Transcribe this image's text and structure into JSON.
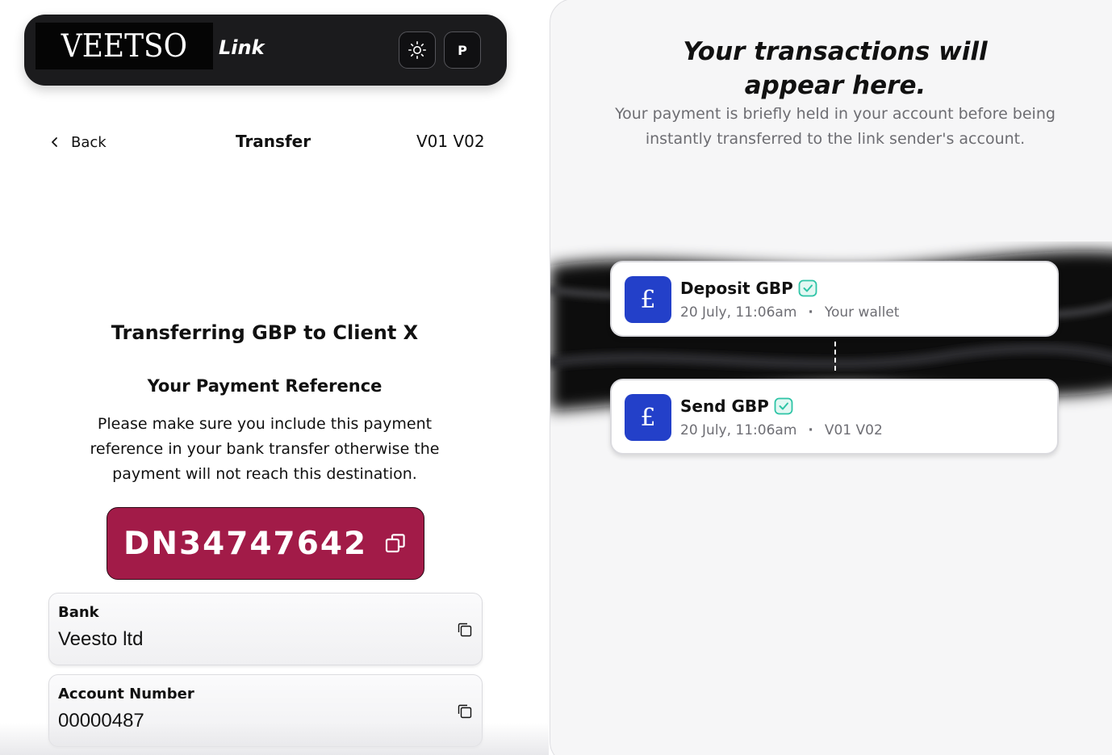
{
  "topbar": {
    "logo_text": "VEETSO",
    "product_label": "Link",
    "profile_initial": "P"
  },
  "nav": {
    "back_label": "Back",
    "title": "Transfer",
    "account_code": "V01 V02"
  },
  "transfer": {
    "heading": "Transferring GBP to Client X",
    "reference_heading": "Your Payment Reference",
    "reference_info": "Please make sure you include this payment reference in your bank transfer otherwise the payment will not reach this destination.",
    "reference_code": "DN34747642"
  },
  "fields": {
    "bank": {
      "label": "Bank",
      "value": "Veesto ltd"
    },
    "account_number": {
      "label": "Account Number",
      "value": "00000487"
    }
  },
  "transactions_panel": {
    "title": "Your transactions will appear here.",
    "subtitle": "Your payment is briefly held in your account before being instantly transferred to the link sender's account.",
    "items": [
      {
        "title": "Deposit GBP",
        "currency_symbol": "£",
        "date": "20 July, 11:06am",
        "target": "Your wallet"
      },
      {
        "title": "Send GBP",
        "currency_symbol": "£",
        "date": "20 July, 11:06am",
        "target": "V01 V02"
      }
    ],
    "separator": "·"
  },
  "colors": {
    "accent_reference": "#a21b48",
    "transaction_icon": "#2340c9",
    "verified_badge": "#2ec4a6",
    "topbar": "#1b1b1d"
  },
  "icons": {
    "theme_toggle": "sun-icon",
    "back": "chevron-left-icon",
    "copy": "copy-icon",
    "verified": "check-badge-icon"
  }
}
